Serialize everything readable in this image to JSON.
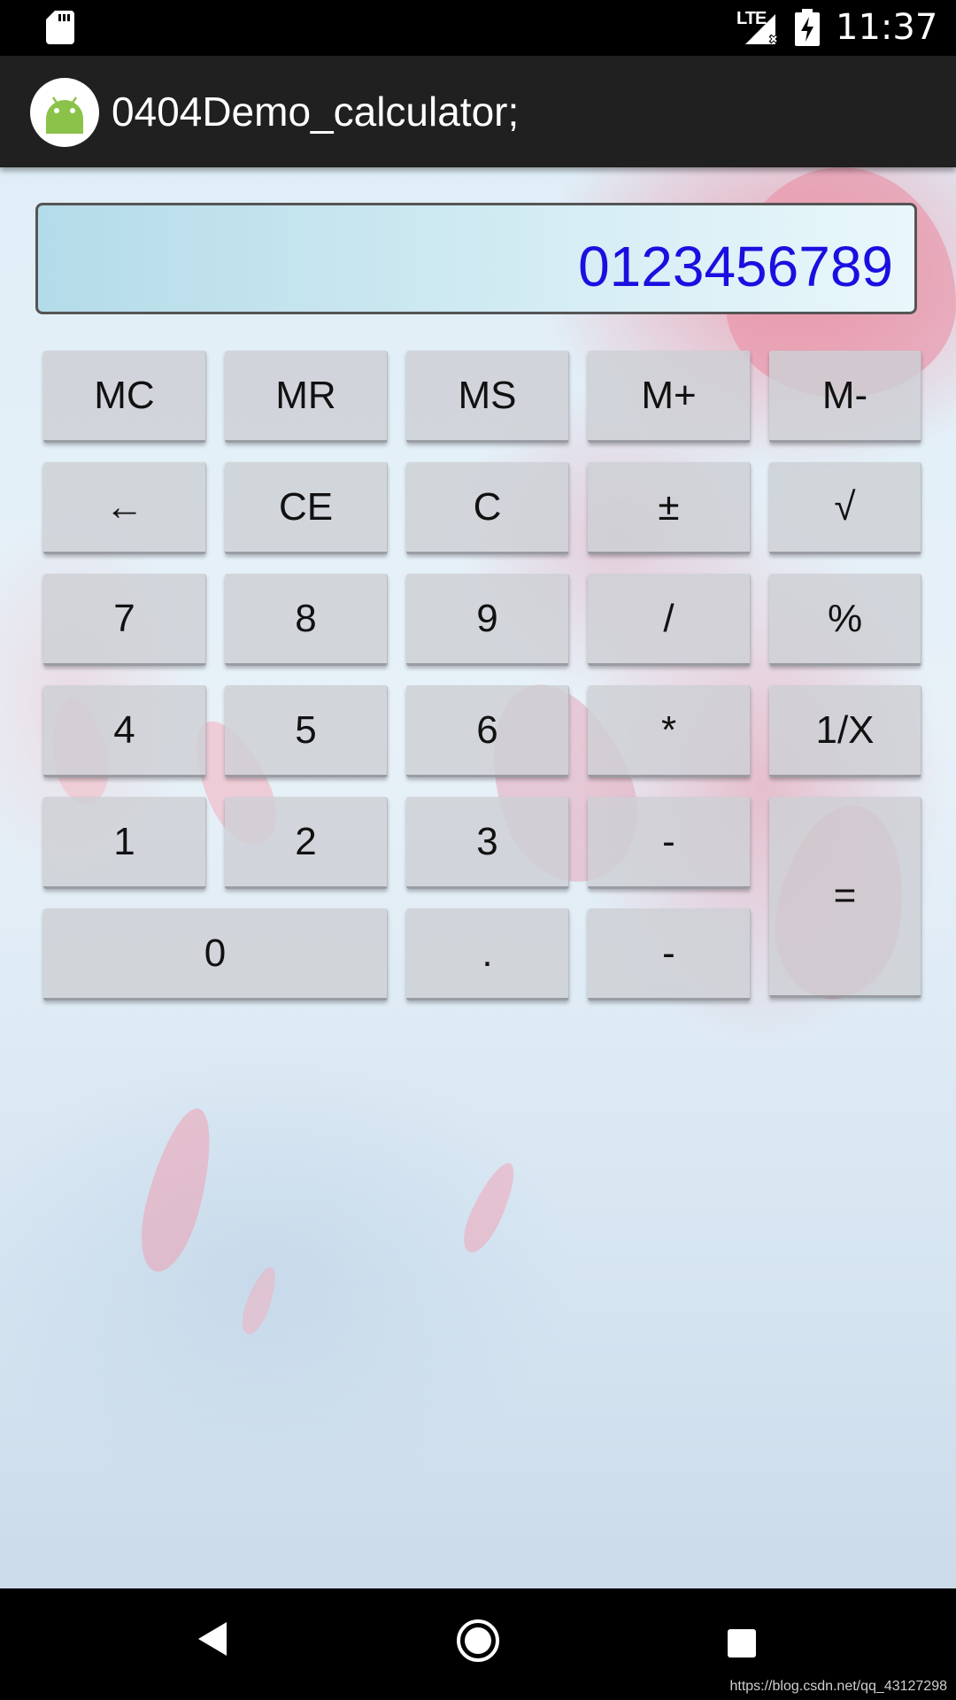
{
  "status_bar": {
    "network": "LTE",
    "time": "11:37",
    "icons": [
      "sd-card-icon",
      "signal-icon",
      "battery-charging-icon"
    ]
  },
  "action_bar": {
    "title": "0404Demo_calculator;",
    "icon": "android-icon"
  },
  "display": {
    "value": "0123456789",
    "text_color": "#1a0fe0"
  },
  "keypad": {
    "mc": "MC",
    "mr": "MR",
    "ms": "MS",
    "m_plus": "M+",
    "m_minus": "M-",
    "backspace": "←",
    "ce": "CE",
    "c": "C",
    "plus_minus": "±",
    "sqrt": "√",
    "n7": "7",
    "n8": "8",
    "n9": "9",
    "divide": "/",
    "percent": "%",
    "n4": "4",
    "n5": "5",
    "n6": "6",
    "multiply": "*",
    "reciprocal": "1/X",
    "n1": "1",
    "n2": "2",
    "n3": "3",
    "minus": "-",
    "equals": "=",
    "n0": "0",
    "dot": ".",
    "minus2": "-"
  },
  "nav_bar": {
    "icons": [
      "back-icon",
      "home-icon",
      "recents-icon"
    ]
  },
  "watermark": "https://blog.csdn.net/qq_43127298"
}
